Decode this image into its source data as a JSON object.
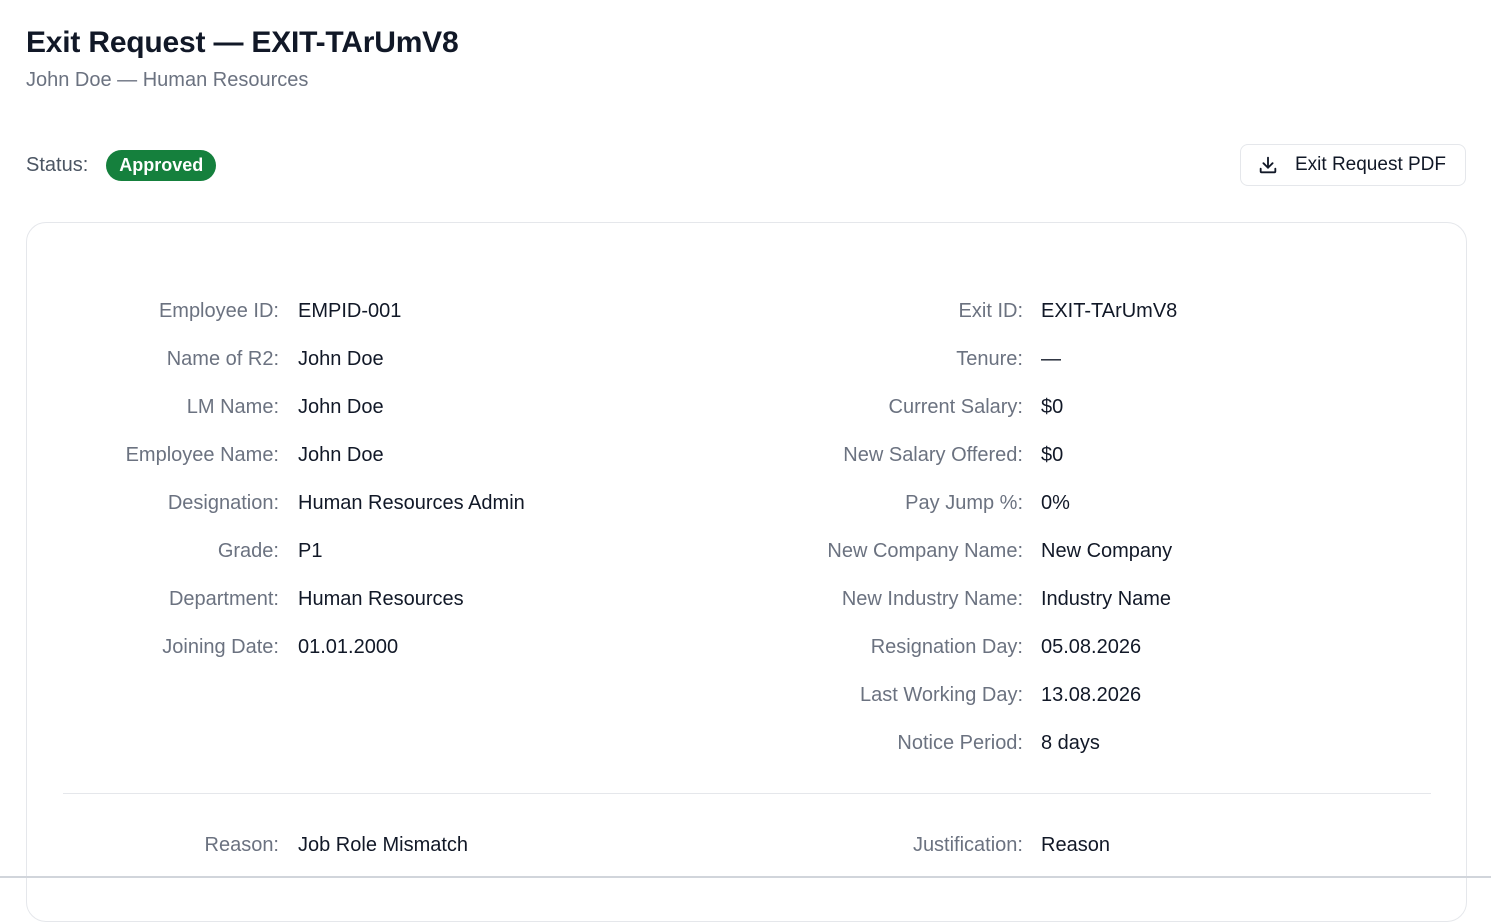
{
  "header": {
    "title": "Exit Request — EXIT-TArUmV8",
    "subtitle": "John Doe — Human Resources"
  },
  "status": {
    "label": "Status:",
    "value": "Approved",
    "color": "#15803d"
  },
  "actions": {
    "pdf_button_label": "Exit Request PDF",
    "pdf_button_icon": "download-icon"
  },
  "details": {
    "left": [
      {
        "label": "Employee ID:",
        "value": "EMPID-001"
      },
      {
        "label": "Name of R2:",
        "value": "John Doe"
      },
      {
        "label": "LM Name:",
        "value": "John Doe"
      },
      {
        "label": "Employee Name:",
        "value": "John Doe"
      },
      {
        "label": "Designation:",
        "value": "Human Resources Admin"
      },
      {
        "label": "Grade:",
        "value": "P1"
      },
      {
        "label": "Department:",
        "value": "Human Resources"
      },
      {
        "label": "Joining Date:",
        "value": "01.01.2000"
      }
    ],
    "right": [
      {
        "label": "Exit ID:",
        "value": "EXIT-TArUmV8"
      },
      {
        "label": "Tenure:",
        "value": "—"
      },
      {
        "label": "Current Salary:",
        "value": "$0"
      },
      {
        "label": "New Salary Offered:",
        "value": "$0"
      },
      {
        "label": "Pay Jump %:",
        "value": "0%"
      },
      {
        "label": "New Company Name:",
        "value": "New Company"
      },
      {
        "label": "New Industry Name:",
        "value": "Industry Name"
      },
      {
        "label": "Resignation Day:",
        "value": "05.08.2026"
      },
      {
        "label": "Last Working Day:",
        "value": "13.08.2026"
      },
      {
        "label": "Notice Period:",
        "value": "8 days"
      }
    ]
  },
  "reason_section": {
    "reason_label": "Reason:",
    "reason_value": "Job Role Mismatch",
    "justification_label": "Justification:",
    "justification_value": "Reason"
  }
}
